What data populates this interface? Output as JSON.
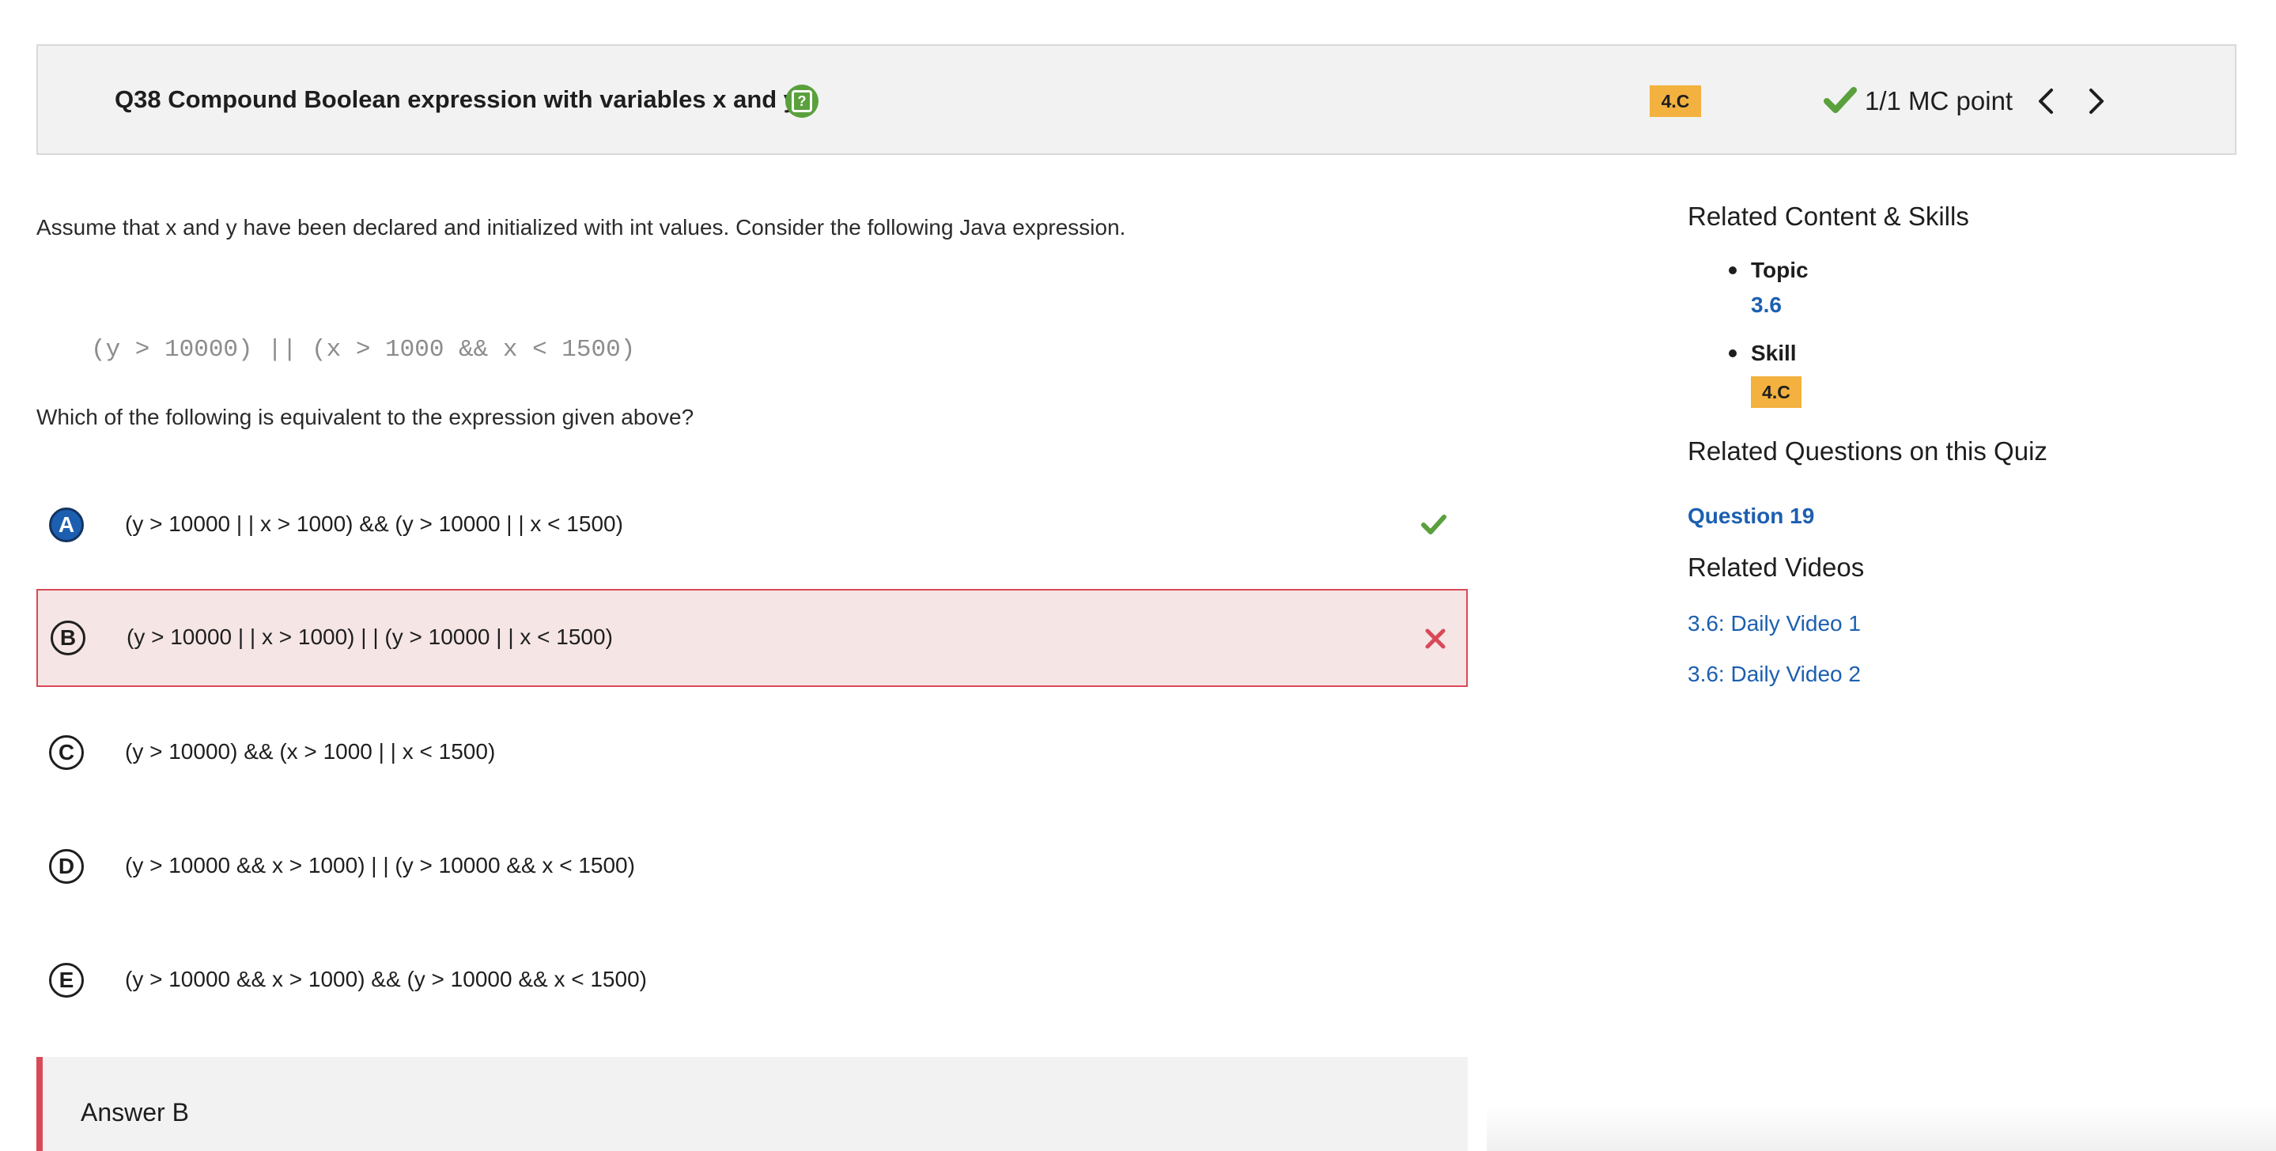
{
  "question": {
    "title": "Q38 Compound Boolean expression with variables x and y",
    "skill_badge": "4.C",
    "score": "1/1 MC point",
    "stem": "Assume that x and y have been declared and initialized with int values. Consider the following Java expression.",
    "code": "(y > 10000) || (x > 1000 && x < 1500)",
    "prompt": "Which of the following is equivalent to the expression given above?"
  },
  "options": [
    {
      "letter": "A",
      "text": "(y > 10000 | | x > 1000) && (y > 10000 | | x < 1500)",
      "status": "correct",
      "selected": true
    },
    {
      "letter": "B",
      "text": "(y > 10000 | | x > 1000) | | (y > 10000 | | x < 1500)",
      "status": "incorrect",
      "selected": false
    },
    {
      "letter": "C",
      "text": "(y > 10000) && (x > 1000 | | x < 1500)",
      "status": "none",
      "selected": false
    },
    {
      "letter": "D",
      "text": "(y > 10000 && x > 1000) | | (y > 10000 && x < 1500)",
      "status": "none",
      "selected": false
    },
    {
      "letter": "E",
      "text": "(y > 10000 && x > 1000) && (y > 10000 && x < 1500)",
      "status": "none",
      "selected": false
    }
  ],
  "answer": {
    "label": "Answer B"
  },
  "sidebar": {
    "related_heading": "Related Content & Skills",
    "topic_label": "Topic",
    "topic_value": "3.6",
    "skill_label": "Skill",
    "skill_value": "4.C",
    "related_questions_heading": "Related Questions on this Quiz",
    "related_question": "Question 19",
    "related_videos_heading": "Related Videos",
    "videos": [
      "3.6: Daily Video 1",
      "3.6: Daily Video 2"
    ]
  },
  "colors": {
    "accent_blue": "#1c5fb0",
    "correct_green": "#5aa03c",
    "incorrect_red": "#d94a58",
    "badge_orange": "#f3b13f"
  },
  "icons": [
    "help-icon",
    "check-icon",
    "chevron-left-icon",
    "chevron-right-icon",
    "x-icon"
  ]
}
